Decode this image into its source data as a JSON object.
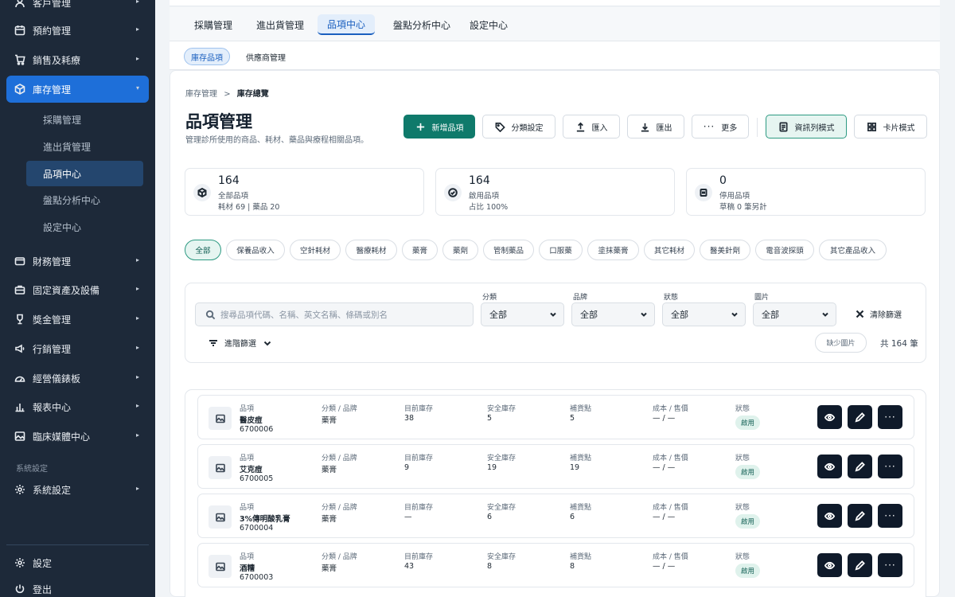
{
  "sidebar": {
    "items": [
      {
        "label": "客戶管理",
        "icon": "user-icon"
      },
      {
        "label": "預約管理",
        "icon": "calendar-icon"
      },
      {
        "label": "銷售及耗療",
        "icon": "cart-icon"
      },
      {
        "label": "庫存管理",
        "icon": "box-icon"
      },
      {
        "label": "財務管理",
        "icon": "wallet-icon"
      },
      {
        "label": "固定資產及設備",
        "icon": "briefcase-icon"
      },
      {
        "label": "獎金管理",
        "icon": "trophy-icon"
      },
      {
        "label": "行銷管理",
        "icon": "megaphone-icon"
      },
      {
        "label": "經營儀錶板",
        "icon": "gauge-icon"
      },
      {
        "label": "報表中心",
        "icon": "bar-chart-icon"
      },
      {
        "label": "臨床媒體中心",
        "icon": "image-icon"
      }
    ],
    "sub_items": [
      "採購管理",
      "進出貨管理",
      "品項中心",
      "盤點分析中心",
      "設定中心"
    ],
    "section_label": "系統設定",
    "system_settings": "系統設定",
    "footer": [
      {
        "label": "設定",
        "icon": "settings-icon"
      },
      {
        "label": "登出",
        "icon": "power-icon"
      }
    ]
  },
  "tabs": [
    "採購管理",
    "進出貨管理",
    "品項中心",
    "盤點分析中心",
    "設定中心"
  ],
  "subtabs": [
    "庫存品項",
    "供應商管理"
  ],
  "breadcrumb": {
    "parent": "庫存管理",
    "separator": ">",
    "current": "庫存總覽"
  },
  "page": {
    "title": "品項管理",
    "subtitle": "管理診所使用的商品、耗材、藥品與療程相關品項。"
  },
  "toolbar": {
    "add": "新增品項",
    "category": "分類設定",
    "import": "匯入",
    "export": "匯出",
    "more": "更多",
    "list_mode": "資訊列模式",
    "card_mode": "卡片模式"
  },
  "stats": [
    {
      "value": "164",
      "label": "全部品項",
      "sub": "耗材 69 | 藥品 20",
      "icon": "cube-icon"
    },
    {
      "value": "164",
      "label": "啟用品項",
      "sub": "占比 100%",
      "icon": "check-circle-icon"
    },
    {
      "value": "0",
      "label": "停用品項",
      "sub": "草稿 0 筆另計",
      "icon": "pause-icon"
    }
  ],
  "chips": [
    "全部",
    "保養品收入",
    "空針耗材",
    "醫療耗材",
    "藥膏",
    "藥劑",
    "管制藥品",
    "口服藥",
    "塗抹藥膏",
    "其它耗材",
    "醫美針劑",
    "電音波探頭",
    "其它產品收入"
  ],
  "filters": {
    "search_placeholder": "搜尋品項代碼、名稱、英文名稱、條碼或別名",
    "labels": [
      "分類",
      "品牌",
      "狀態",
      "圖片"
    ],
    "values": [
      "全部",
      "全部",
      "全部",
      "全部"
    ],
    "clear": "清除篩選",
    "advanced": "進階篩選",
    "missing_image": "缺少圖片",
    "total": "共 164 筆"
  },
  "columns": {
    "item": "品項",
    "category": "分類 / 品牌",
    "stock": "目前庫存",
    "safety": "安全庫存",
    "reorder": "補貨點",
    "cost": "成本 / 售價",
    "status": "狀態"
  },
  "rows": [
    {
      "name": "醫皮痘",
      "code": "6700006",
      "category": "藥膏",
      "stock": "38",
      "safety": "5",
      "reorder": "5",
      "cost": "— / —",
      "status": "啟用"
    },
    {
      "name": "艾克痘",
      "code": "6700005",
      "category": "藥膏",
      "stock": "9",
      "safety": "19",
      "reorder": "19",
      "cost": "— / —",
      "status": "啟用"
    },
    {
      "name": "3%傳明酸乳膏",
      "code": "6700004",
      "category": "藥膏",
      "stock": "—",
      "safety": "6",
      "reorder": "6",
      "cost": "— / —",
      "status": "啟用"
    },
    {
      "name": "酒糟",
      "code": "6700003",
      "category": "藥膏",
      "stock": "43",
      "safety": "8",
      "reorder": "8",
      "cost": "— / —",
      "status": "啟用"
    }
  ]
}
